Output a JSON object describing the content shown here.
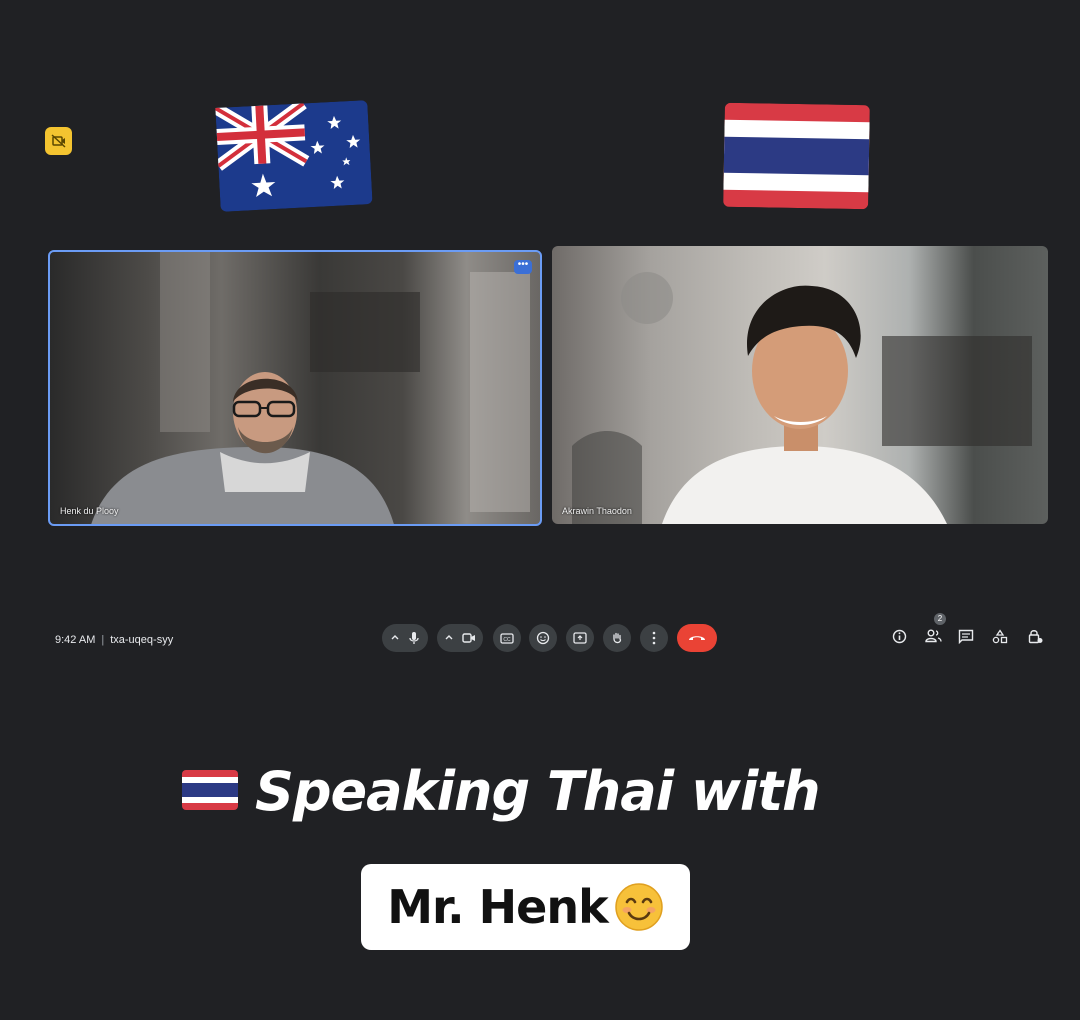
{
  "participants": [
    {
      "name": "Henk du Plooy"
    },
    {
      "name": "Akrawin Thaodon"
    }
  ],
  "controls": {
    "time": "9:42 AM",
    "meeting_code": "txa-uqeq-syy",
    "people_count": "2"
  },
  "caption": {
    "line1": "Speaking Thai with",
    "name": "Mr. Henk"
  },
  "icons": {
    "top_badge": "camera-off-icon",
    "mic": "microphone-icon",
    "camera": "video-camera-icon",
    "captions": "captions-icon",
    "emoji": "emoji-icon",
    "present": "present-screen-icon",
    "raise_hand": "raise-hand-icon",
    "more": "more-vert-icon",
    "end_call": "end-call-icon",
    "info": "info-icon",
    "people": "people-icon",
    "chat": "chat-icon",
    "activities": "activities-icon",
    "host_controls": "lock-person-icon"
  },
  "colors": {
    "background": "#202124",
    "end_call": "#ea4335",
    "active_border": "#6b9cf5",
    "badge": "#f4c430"
  }
}
